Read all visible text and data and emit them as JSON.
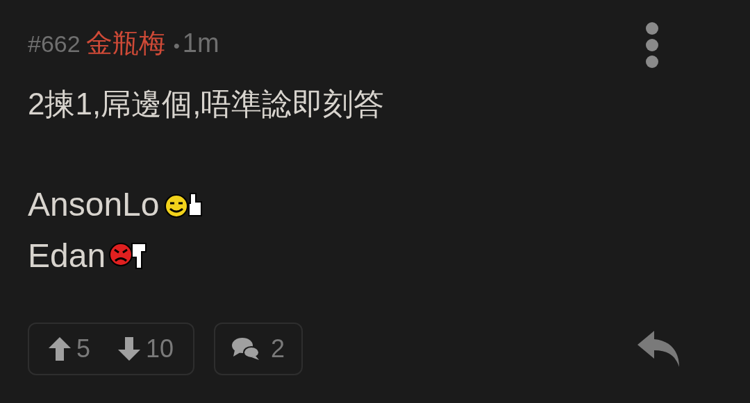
{
  "post": {
    "number": "#662",
    "author": "金瓶梅",
    "separator": "•",
    "time": "1m"
  },
  "body": {
    "text": "2揀1,屌邊個,唔準諗即刻答",
    "picks": [
      {
        "name": "AnsonLo",
        "kind": "up"
      },
      {
        "name": "Edan",
        "kind": "down"
      }
    ]
  },
  "actions": {
    "upvotes": "5",
    "downvotes": "10",
    "comments": "2"
  }
}
